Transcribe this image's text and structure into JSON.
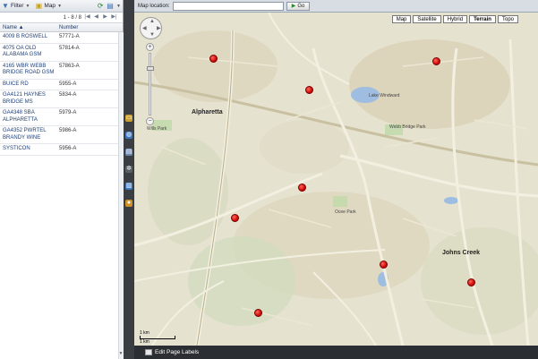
{
  "toolbar": {
    "filter_label": "Filter",
    "map_label": "Map"
  },
  "pager": {
    "range": "1 - 8 / 8"
  },
  "table": {
    "col_name": "Name",
    "col_number": "Number",
    "rows": [
      {
        "name": "4009 B ROSWELL",
        "number": "57771-A"
      },
      {
        "name": "4075 OA OLD ALABAMA GSM",
        "number": "57814-A"
      },
      {
        "name": "4165 WBR WEBB BRIDGE ROAD GSM",
        "number": "57863-A"
      },
      {
        "name": "BUICE RD",
        "number": "5955-A"
      },
      {
        "name": "GA4121 HAYNES BRIDGE MS",
        "number": "5834-A"
      },
      {
        "name": "GA4348 SBA ALPHARETTA",
        "number": "5979-A"
      },
      {
        "name": "GA4352 PWRTEL BRANDY WINE",
        "number": "5986-A"
      },
      {
        "name": "SYSTICON",
        "number": "5956-A"
      }
    ]
  },
  "locbar": {
    "label": "Map location:",
    "input_value": "",
    "go_label": "Go"
  },
  "map": {
    "types": [
      "Map",
      "Satellite",
      "Hybrid",
      "Terrain",
      "Topo"
    ],
    "active_type": "Terrain",
    "places": {
      "alpharetta": "Alpharetta",
      "johns_creek": "Johns Creek",
      "lake_windward": "Lake Windward",
      "webb_bridge_park": "Webb Bridge Park",
      "ocee_park": "Ocee Park",
      "wills_park": "Wills Park"
    },
    "scale": {
      "top": "1 km",
      "bottom": "1 km"
    }
  },
  "bottom": {
    "edit_label": "Edit Page Labels"
  },
  "colors": {
    "marker": "#d20a0a",
    "panel_dark": "#3a3d41",
    "link_blue": "#1d3f7a"
  }
}
